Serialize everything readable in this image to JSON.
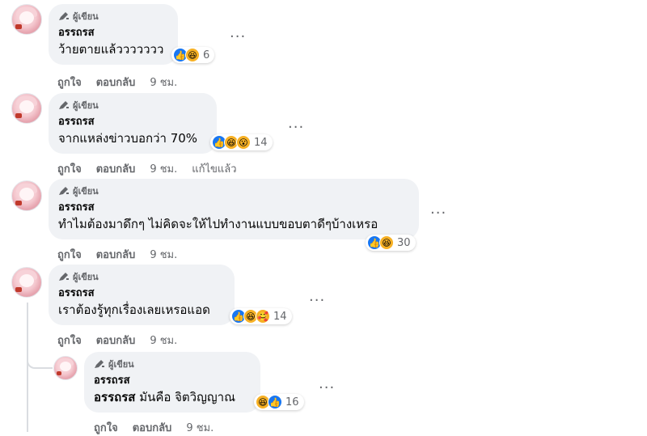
{
  "comments": [
    {
      "badge": "ผู้เขียน",
      "name": "อรรถรส",
      "text": "ว้ายตายแล้ววววววว",
      "reactions": [
        "like",
        "haha"
      ],
      "count": "6",
      "actions": {
        "like": "ถูกใจ",
        "reply": "ตอบกลับ",
        "time": "9 ชม."
      }
    },
    {
      "badge": "ผู้เขียน",
      "name": "อรรถรส",
      "text": "จากแหล่งข่าวบอกว่า 70%",
      "reactions": [
        "like",
        "haha",
        "wow"
      ],
      "count": "14",
      "actions": {
        "like": "ถูกใจ",
        "reply": "ตอบกลับ",
        "time": "9 ชม.",
        "edited": "แก้ไขแล้ว"
      }
    },
    {
      "badge": "ผู้เขียน",
      "name": "อรรถรส",
      "text": "ทำไมต้องมาดึกๆ ไม่คิดจะให้ไปทำงานแบบขอบตาดีๆบ้างเหรอ",
      "reactions": [
        "like",
        "haha"
      ],
      "count": "30",
      "actions": {
        "like": "ถูกใจ",
        "reply": "ตอบกลับ",
        "time": "9 ชม."
      }
    },
    {
      "badge": "ผู้เขียน",
      "name": "อรรถรส",
      "text": "เราต้องรู้ทุกเรื่องเลยเหรอแอด",
      "reactions": [
        "like",
        "haha",
        "care"
      ],
      "count": "14",
      "actions": {
        "like": "ถูกใจ",
        "reply": "ตอบกลับ",
        "time": "9 ชม."
      }
    },
    {
      "badge": "ผู้เขียน",
      "name": "อรรถรส",
      "mention": "อรรถรส",
      "text": " มันคือ จิตวิญญาณ",
      "reactions": [
        "haha",
        "like"
      ],
      "count": "16",
      "actions": {
        "like": "ถูกใจ",
        "reply": "ตอบกลับ",
        "time": "9 ชม."
      }
    }
  ],
  "more_label": "...",
  "colors": {
    "bubble": "#f0f2f5",
    "like": "#1877f2",
    "secondary": "#65676b"
  }
}
